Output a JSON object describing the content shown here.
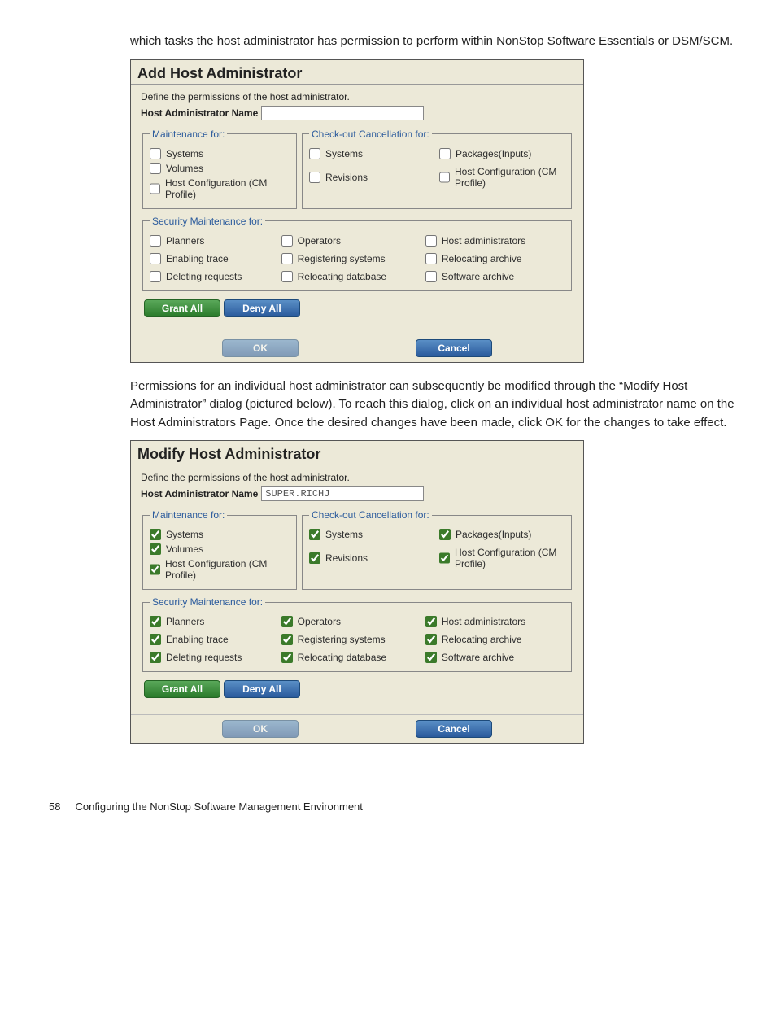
{
  "intro_text": "which tasks the host administrator has permission to perform within NonStop Software Essentials or DSM/SCM.",
  "mid_text": "Permissions for an individual host administrator can subsequently be modified through the “Modify Host Administrator” dialog (pictured below). To reach this dialog, click on an individual host administrator name on the Host Administrators Page. Once the desired changes have been made, click OK for the changes to take effect.",
  "footer": {
    "page": "58",
    "section": "Configuring the NonStop Software Management Environment"
  },
  "labels": {
    "instr": "Define the permissions of the host administrator.",
    "name_label": "Host Administrator Name",
    "maint_legend": "Maintenance for:",
    "checkout_legend": "Check-out Cancellation for:",
    "sec_legend": "Security Maintenance for:",
    "grant": "Grant All",
    "deny": "Deny All",
    "ok": "OK",
    "cancel": "Cancel"
  },
  "options": {
    "maint": [
      "Systems",
      "Volumes",
      "Host Configuration (CM Profile)"
    ],
    "checkout": [
      "Systems",
      "Revisions",
      "Packages(Inputs)",
      "Host Configuration (CM Profile)"
    ],
    "security": [
      "Planners",
      "Operators",
      "Host administrators",
      "Enabling trace",
      "Registering systems",
      "Relocating archive",
      "Deleting requests",
      "Relocating database",
      "Software archive"
    ]
  },
  "dialog1": {
    "title": "Add Host Administrator",
    "name_value": "",
    "all_checked": false
  },
  "dialog2": {
    "title": "Modify Host Administrator",
    "name_value": "SUPER.RICHJ",
    "all_checked": true
  }
}
